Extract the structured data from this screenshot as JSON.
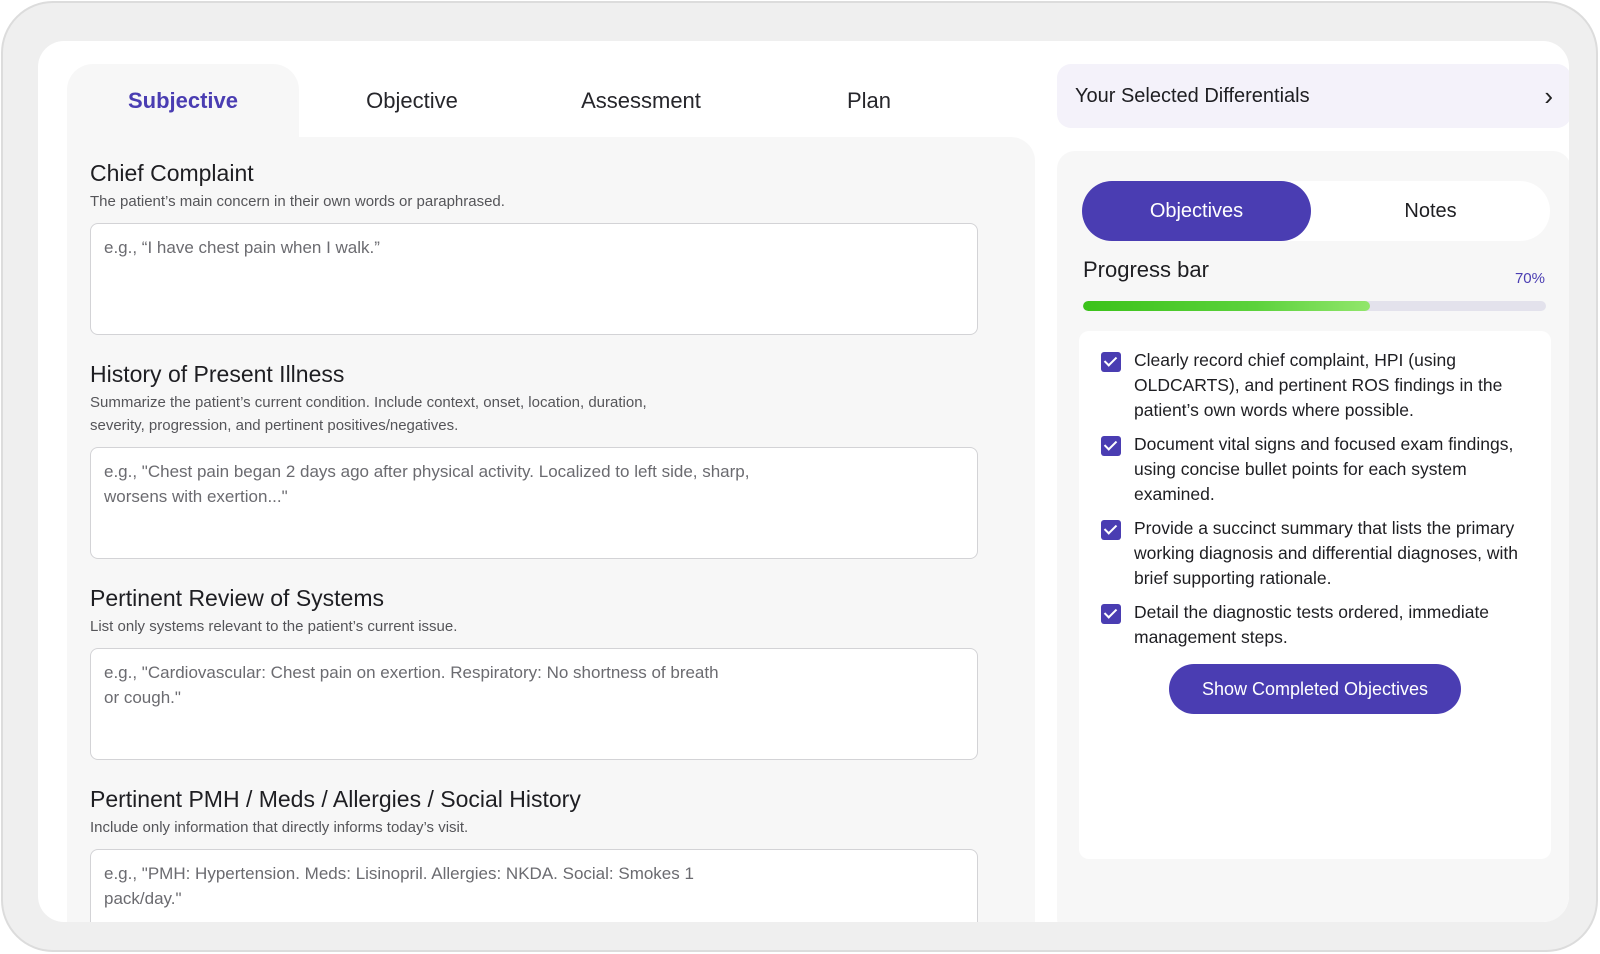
{
  "tabs": [
    {
      "label": "Subjective",
      "active": true
    },
    {
      "label": "Objective",
      "active": false
    },
    {
      "label": "Assessment",
      "active": false
    },
    {
      "label": "Plan",
      "active": false
    }
  ],
  "sections": [
    {
      "title": "Chief Complaint",
      "description": "The patient’s main concern in their own words or paraphrased.",
      "placeholder": "e.g., “I have chest pain when I walk.”",
      "value": ""
    },
    {
      "title": "History of Present Illness",
      "description": "Summarize the patient’s current condition. Include context, onset, location, duration, severity, progression, and pertinent positives/negatives.",
      "placeholder": "e.g., \"Chest pain began 2 days ago after physical activity. Localized to left side, sharp, worsens with exertion...\"",
      "value": ""
    },
    {
      "title": "Pertinent Review of Systems",
      "description": "List only systems relevant to the patient’s current issue.",
      "placeholder": "e.g., \"Cardiovascular: Chest pain on exertion. Respiratory: No shortness of breath or cough.\"",
      "value": ""
    },
    {
      "title": "Pertinent PMH / Meds / Allergies / Social History",
      "description": "Include only information that directly informs today’s visit.",
      "placeholder": "e.g., \"PMH: Hypertension. Meds: Lisinopril. Allergies: NKDA. Social: Smokes 1 pack/day.\"",
      "value": ""
    }
  ],
  "differentials": {
    "title": "Your Selected Differentials",
    "icon": "chevron-right-icon"
  },
  "sidebar": {
    "toggle": {
      "objectives_label": "Objectives",
      "notes_label": "Notes",
      "selected": "Objectives"
    },
    "progress": {
      "title": "Progress bar",
      "percent_label": "70%",
      "value": 0.62
    },
    "objectives": [
      {
        "text": "Clearly record chief complaint, HPI (using OLDCARTS), and pertinent ROS findings in the patient’s own words where possible.",
        "checked": true
      },
      {
        "text": "Document vital signs and focused exam findings, using concise bullet points for each system examined.",
        "checked": true
      },
      {
        "text": "Provide a succinct summary that lists the primary working diagnosis and differential diagnoses, with brief supporting rationale.",
        "checked": true
      },
      {
        "text": "Detail the diagnostic tests ordered, immediate management steps.",
        "checked": true
      }
    ],
    "show_completed_label": "Show Completed Objectives"
  },
  "colors": {
    "accent": "#4a3db2",
    "progress_green": "#3bc21a",
    "panel_bg": "#f7f7f7"
  }
}
